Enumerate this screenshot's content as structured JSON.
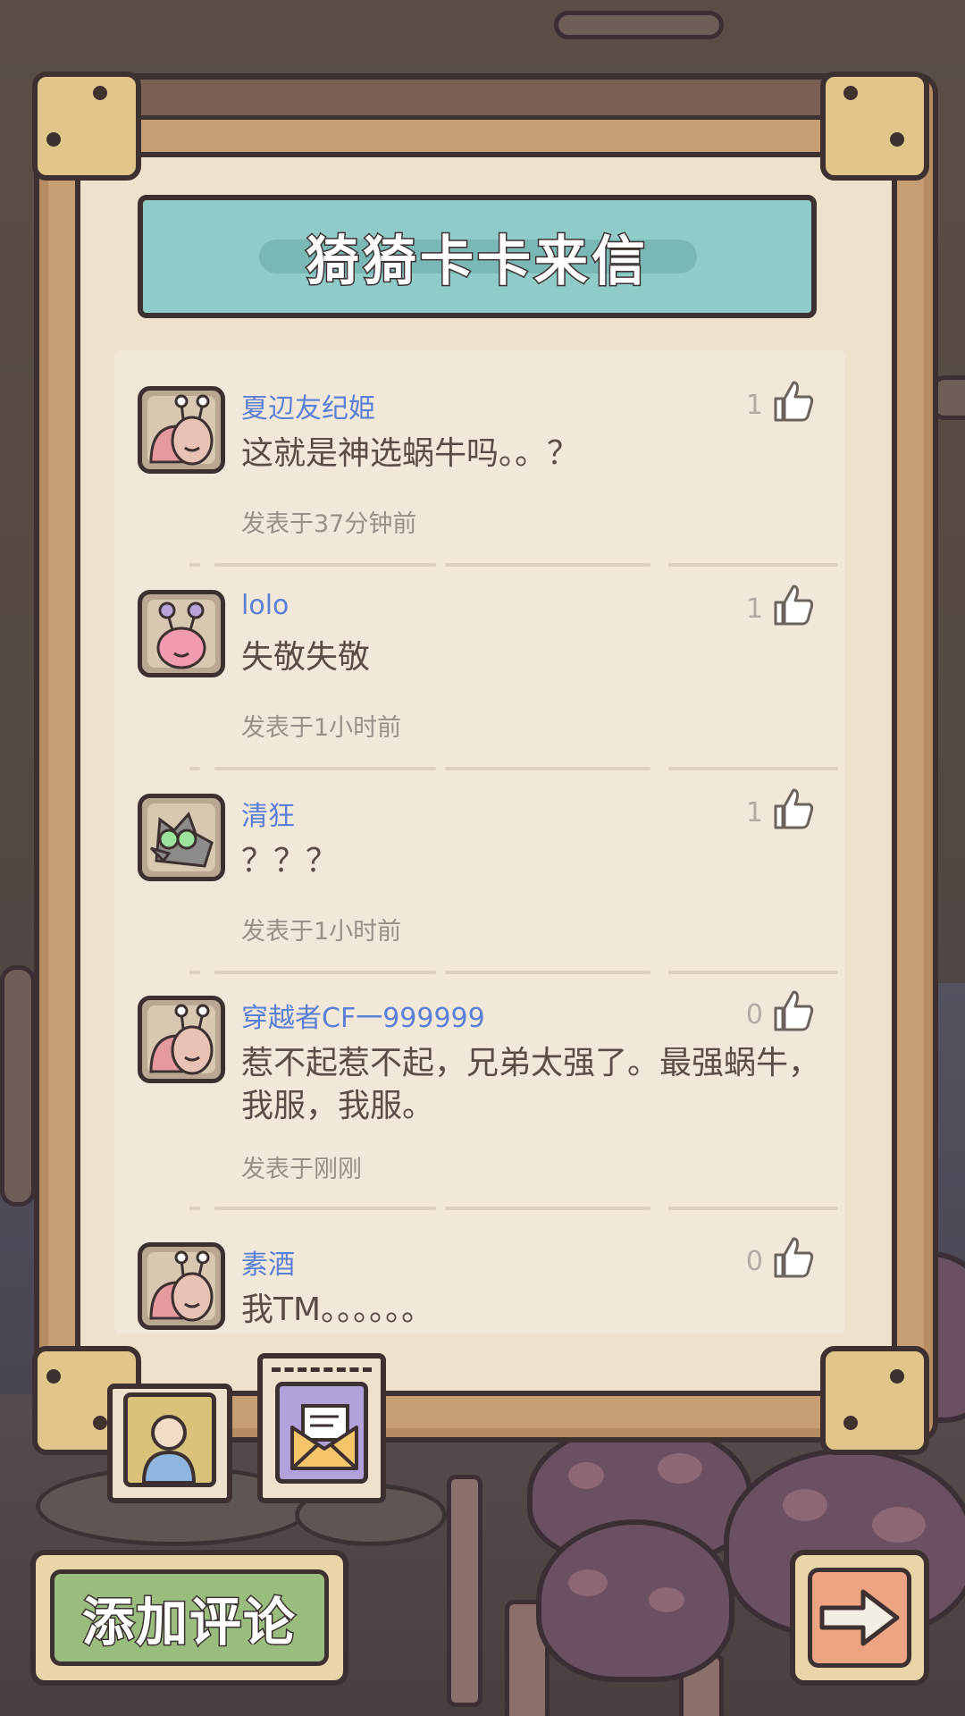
{
  "banner": {
    "title": "猗猗卡卡来信"
  },
  "comments": [
    {
      "username": "夏辺友纪姫",
      "text": "这就是神选蜗牛吗。。？",
      "time": "发表于37分钟前",
      "likes": "1",
      "avatar": "snail-avatar-icon"
    },
    {
      "username": "lolo",
      "text": "失敬失敬",
      "time": "发表于1小时前",
      "likes": "1",
      "avatar": "pink-snail-avatar-icon"
    },
    {
      "username": "清狂",
      "text": "？？？",
      "time": "发表于1小时前",
      "likes": "1",
      "avatar": "wolf-avatar-icon"
    },
    {
      "username": "穿越者CF一999999",
      "text": "惹不起惹不起，兄弟太强了。最强蜗牛，我服，我服。",
      "time": "发表于刚刚",
      "likes": "0",
      "avatar": "snail-avatar-icon"
    },
    {
      "username": "素酒",
      "text": "我TM。。。。。。",
      "time": "",
      "likes": "0",
      "avatar": "snail-avatar-icon"
    }
  ],
  "tabs": [
    {
      "name": "tab-profile",
      "icon": "person-icon",
      "active": false
    },
    {
      "name": "tab-mail",
      "icon": "envelope-icon",
      "active": true
    }
  ],
  "buttons": {
    "add_comment": "添加评论",
    "next": "arrow-right-icon"
  },
  "colors": {
    "username": "#5a7fd4",
    "banner": "#8fcbc8",
    "add_button": "#98bd7c",
    "next_button": "#eda482",
    "paper": "#efe2cc"
  }
}
